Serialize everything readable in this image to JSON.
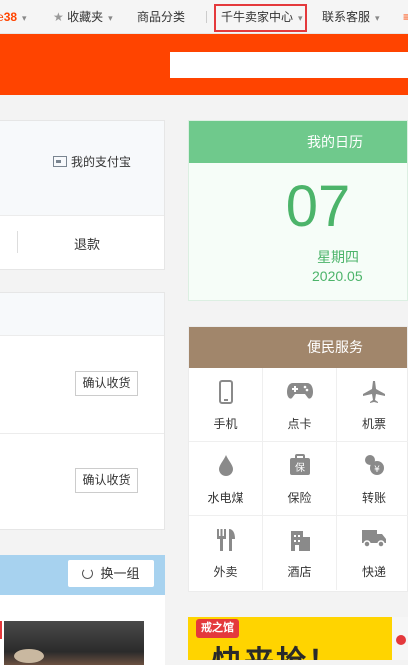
{
  "topnav": {
    "cart_partial": "e",
    "cart_count": "38",
    "favorites": "收藏夹",
    "categories": "商品分类",
    "seller_center": "千牛卖家中心",
    "contact": "联系客服",
    "menu_glyph": "≡"
  },
  "account": {
    "alipay_link": "我的支付宝",
    "refund": "退款"
  },
  "orders": {
    "confirm_label": "确认收货"
  },
  "recommend": {
    "swap_label": "换一组"
  },
  "calendar": {
    "title": "我的日历",
    "day": "07",
    "weekday": "星期四",
    "month": "2020.05"
  },
  "services": {
    "title": "便民服务",
    "items": [
      {
        "label": "手机",
        "icon": "phone-icon"
      },
      {
        "label": "点卡",
        "icon": "gamepad-icon"
      },
      {
        "label": "机票",
        "icon": "airplane-icon"
      },
      {
        "label": "水电煤",
        "icon": "water-drop-icon"
      },
      {
        "label": "保险",
        "icon": "insurance-icon"
      },
      {
        "label": "转账",
        "icon": "transfer-icon"
      },
      {
        "label": "外卖",
        "icon": "takeout-icon"
      },
      {
        "label": "酒店",
        "icon": "hotel-icon"
      },
      {
        "label": "快递",
        "icon": "delivery-truck-icon"
      }
    ]
  },
  "promo": {
    "tag": "戒之馆",
    "headline": "快来抢！"
  },
  "colors": {
    "brand_orange": "#ff4400",
    "calendar_green": "#6fc98c",
    "service_brown": "#a1866b",
    "highlight_red": "#e4393c"
  }
}
